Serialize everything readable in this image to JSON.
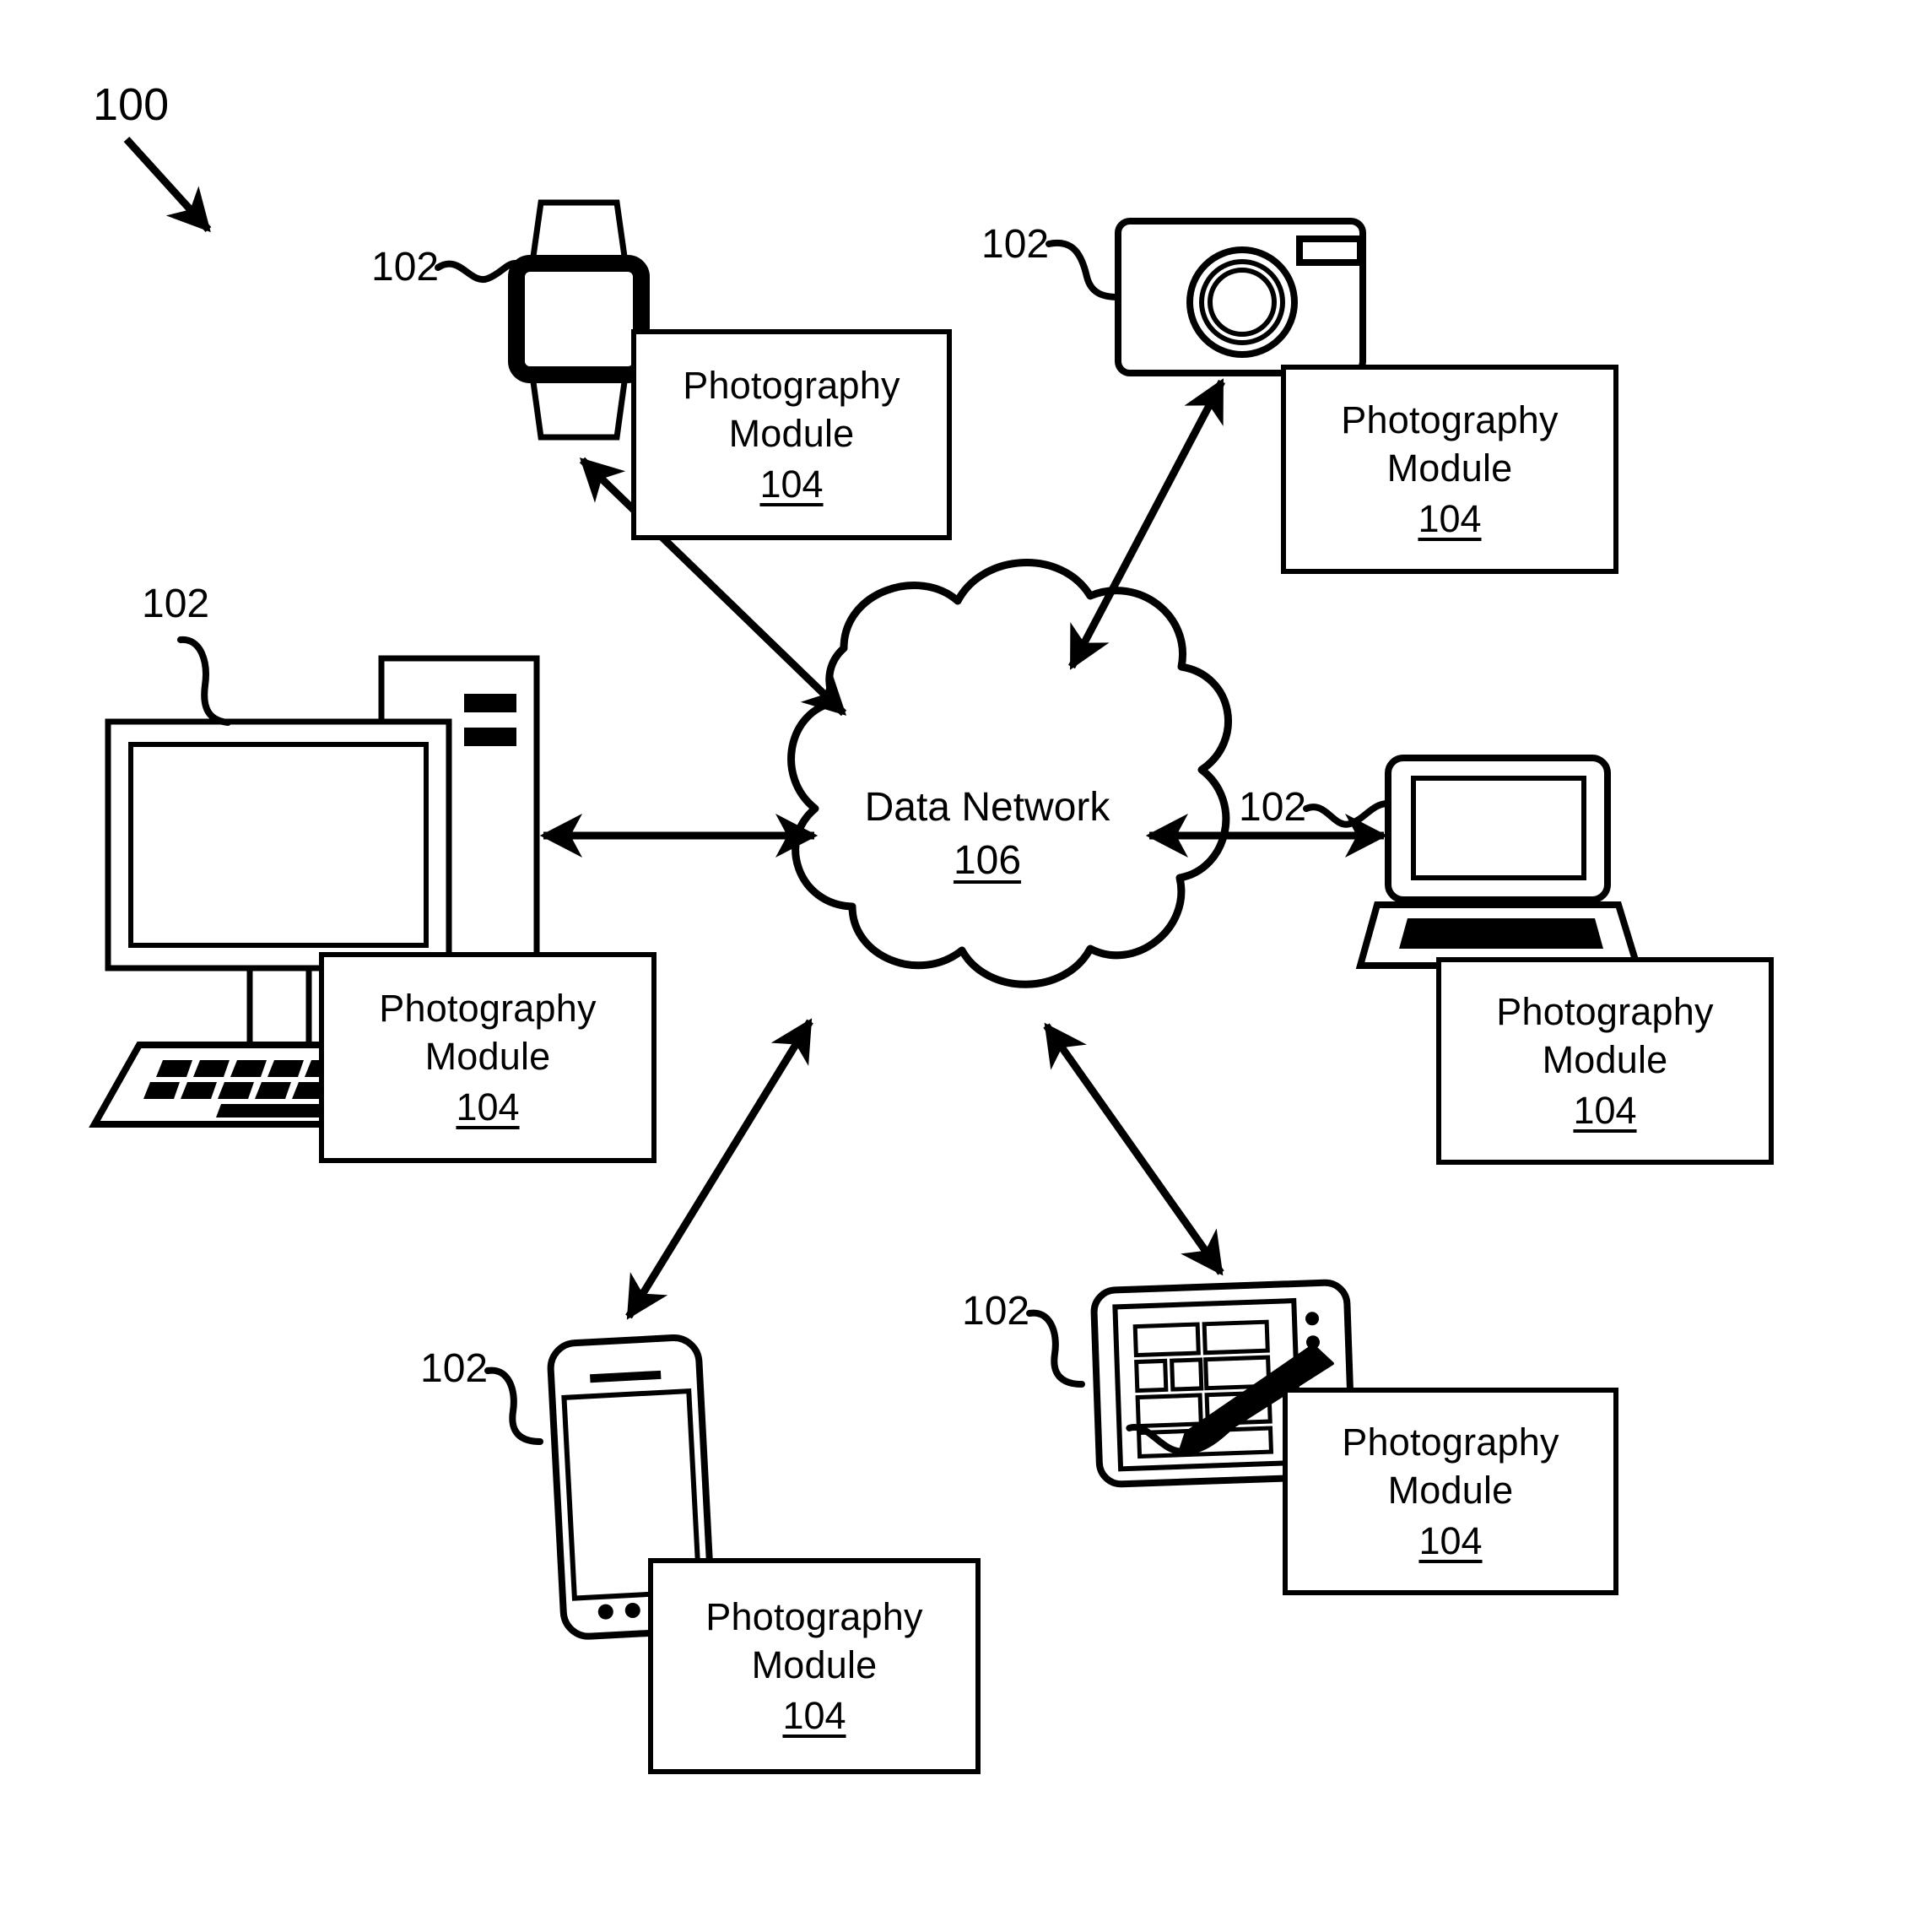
{
  "figure": {
    "number": "100",
    "reference_label": "102",
    "module_title": "Photography\nModule",
    "module_ref": "104",
    "network_name": "Data Network",
    "network_ref": "106",
    "stroke_color": "#000000",
    "background_color": "#ffffff"
  },
  "network": {
    "label": "Data Network",
    "ref": "106"
  },
  "nodes": [
    {
      "id": "smartwatch",
      "device": "smartwatch",
      "ref": "102",
      "module_title": "Photography\nModule",
      "module_ref": "104"
    },
    {
      "id": "camera",
      "device": "digital-camera",
      "ref": "102",
      "module_title": "Photography\nModule",
      "module_ref": "104"
    },
    {
      "id": "desktop",
      "device": "desktop-computer",
      "ref": "102",
      "module_title": "Photography\nModule",
      "module_ref": "104"
    },
    {
      "id": "laptop",
      "device": "laptop-computer",
      "ref": "102",
      "module_title": "Photography\nModule",
      "module_ref": "104"
    },
    {
      "id": "smartphone",
      "device": "smartphone",
      "ref": "102",
      "module_title": "Photography\nModule",
      "module_ref": "104"
    },
    {
      "id": "tablet",
      "device": "tablet-with-stylus",
      "ref": "102",
      "module_title": "Photography\nModule",
      "module_ref": "104"
    }
  ]
}
